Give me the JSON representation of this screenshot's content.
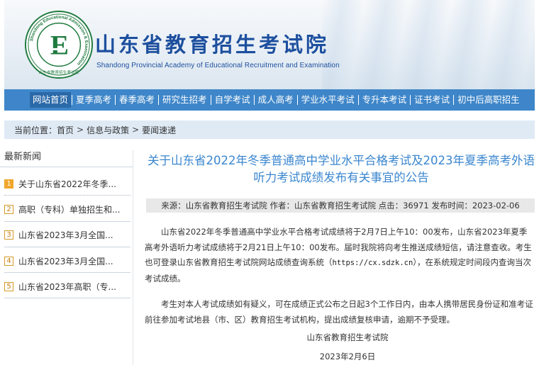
{
  "header": {
    "title": "山东省教育招生考试院",
    "subtitle": "Shandong Provincial Academy of Educational Recruitment and Examination",
    "logo_ring_text": "Shandong Educational Admission & Examination",
    "logo_bottom_text": "山东省教育招生考试院",
    "logo_letter": "E",
    "colors": {
      "title": "#1d4f9e",
      "logo_green": "#1f7a3e"
    }
  },
  "nav": {
    "items": [
      {
        "label": "网站首页"
      },
      {
        "label": "夏季高考"
      },
      {
        "label": "春季高考"
      },
      {
        "label": "研究生招考"
      },
      {
        "label": "自学考试"
      },
      {
        "label": "成人高考"
      },
      {
        "label": "学业水平考试"
      },
      {
        "label": "专升本考试"
      },
      {
        "label": "证书考试"
      },
      {
        "label": "初中后高职招生"
      }
    ],
    "active_index": 0,
    "color": "#3e86c9"
  },
  "breadcrumb": {
    "prefix": "当前位置：",
    "items": [
      "首页",
      "信息与政策",
      "要闻速递"
    ],
    "separator": ">"
  },
  "sidebar": {
    "title": "最新新闻",
    "items": [
      {
        "num": "1",
        "text": "关于山东省2022年冬季..."
      },
      {
        "num": "2",
        "text": "高职（专科）单独招生和..."
      },
      {
        "num": "3",
        "text": "山东省2023年3月全国..."
      },
      {
        "num": "4",
        "text": "山东省2023年3月全国..."
      },
      {
        "num": "5",
        "text": "山东省2023年高职（专..."
      }
    ]
  },
  "article": {
    "title": "关于山东省2022年冬季普通高中学业水平合格考试及2023年夏季高考外语听力考试成绩发布有关事宜的公告",
    "meta": "来源：山东省教育招生考试院  作者：山东省教育招生考试院  点击：36971  发布时间：2023-02-06",
    "para1_before": "山东省2022年冬季普通高中学业水平合格考试成绩将于2月7日上午10：00发布，山东省2023年夏季高考外语听力考试成绩将于2月21日上午10：00发布。届时我院将向考生推送成绩短信，请注意查收。考生也可登录山东省教育招生考试院网站成绩查询系统（",
    "link": "https://cx.sdzk.cn",
    "para1_after": "），在系统规定时间段内查询当次考试成绩。",
    "para2": "考生对本人考试成绩如有疑义，可在成绩正式公布之日起3个工作日内，由本人携带居民身份证和准考证前往参加考试地县（市、区）教育招生考试机构，提出成绩复核申请，逾期不予受理。",
    "sign_org": "山东省教育招生考试院",
    "sign_date": "2023年2月6日"
  }
}
